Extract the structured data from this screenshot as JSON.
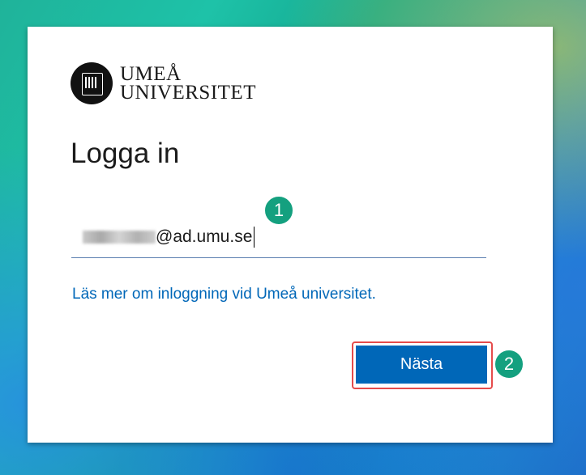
{
  "brand": {
    "name_line1": "UMEÅ",
    "name_line2": "UNIVERSITET",
    "logo_icon": "umea-university-seal"
  },
  "signin": {
    "title": "Logga in",
    "email_value": "@ad.umu.se",
    "learn_more_link": "Läs mer om inloggning vid Umeå universitet.",
    "next_label": "Nästa"
  },
  "annotations": {
    "step1": "1",
    "step2": "2"
  },
  "colors": {
    "accent": "#0067b8",
    "badge": "#14a07f",
    "highlight": "#e54b4b"
  }
}
